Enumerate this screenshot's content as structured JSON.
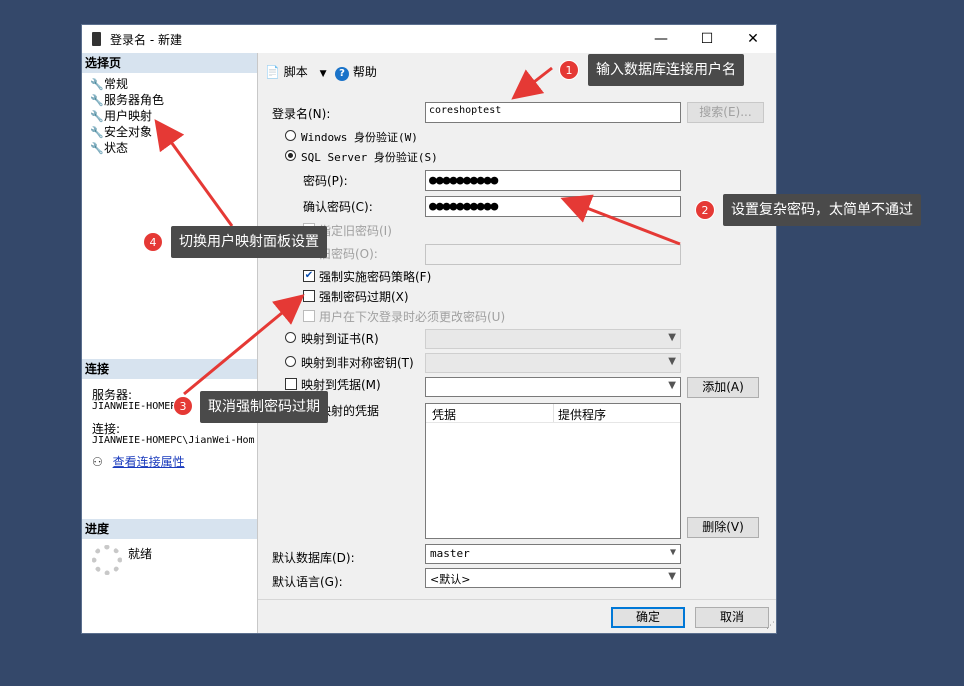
{
  "window": {
    "title": "登录名 - 新建",
    "controls": {
      "minimize": "—",
      "maximize": "☐",
      "close": "✕"
    }
  },
  "left_pane": {
    "select_page_header": "选择页",
    "pages": [
      "常规",
      "服务器角色",
      "用户映射",
      "安全对象",
      "状态"
    ],
    "connection_header": "连接",
    "server_label": "服务器:",
    "server_value": "JIANWEIE-HOMEP",
    "connection_label": "连接:",
    "connection_value": "JIANWEIE-HOMEPC\\JianWei-Hom",
    "view_connection_link": "查看连接属性",
    "progress_header": "进度",
    "progress_status": "就绪"
  },
  "toolbar": {
    "script_label": "脚本",
    "help_label": "帮助"
  },
  "form": {
    "login_name_label": "登录名(N):",
    "login_name_value": "coreshoptest",
    "search_button": "搜索(E)...",
    "windows_auth": "Windows 身份验证(W)",
    "sql_auth": "SQL Server 身份验证(S)",
    "password_label": "密码(P):",
    "password_mask": "●●●●●●●●●●",
    "confirm_label": "确认密码(C):",
    "confirm_mask": "●●●●●●●●●●",
    "specify_old": "指定旧密码(I)",
    "old_password_label": "旧密码(O):",
    "enforce_policy": "强制实施密码策略(F)",
    "enforce_expiration": "强制密码过期(X)",
    "must_change": "用户在下次登录时必须更改密码(U)",
    "map_cert": "映射到证书(R)",
    "map_asym": "映射到非对称密钥(T)",
    "map_credential": "映射到凭据(M)",
    "add_button": "添加(A)",
    "mapped_credentials_label": "映射的凭据",
    "col_credential": "凭据",
    "col_provider": "提供程序",
    "remove_button": "删除(V)",
    "default_db_label": "默认数据库(D):",
    "default_db_value": "master",
    "default_lang_label": "默认语言(G):",
    "default_lang_value": "<默认>",
    "ok_button": "确定",
    "cancel_button": "取消"
  },
  "annotations": [
    {
      "num": "1",
      "text": "输入数据库连接用户名"
    },
    {
      "num": "2",
      "text": "设置复杂密码，太简单不通过"
    },
    {
      "num": "3",
      "text": "取消强制密码过期"
    },
    {
      "num": "4",
      "text": "切换用户映射面板设置"
    }
  ],
  "colors": {
    "background": "#34486a",
    "callout": "#4a4a4a",
    "badge": "#e53935",
    "arrow": "#e53935"
  }
}
